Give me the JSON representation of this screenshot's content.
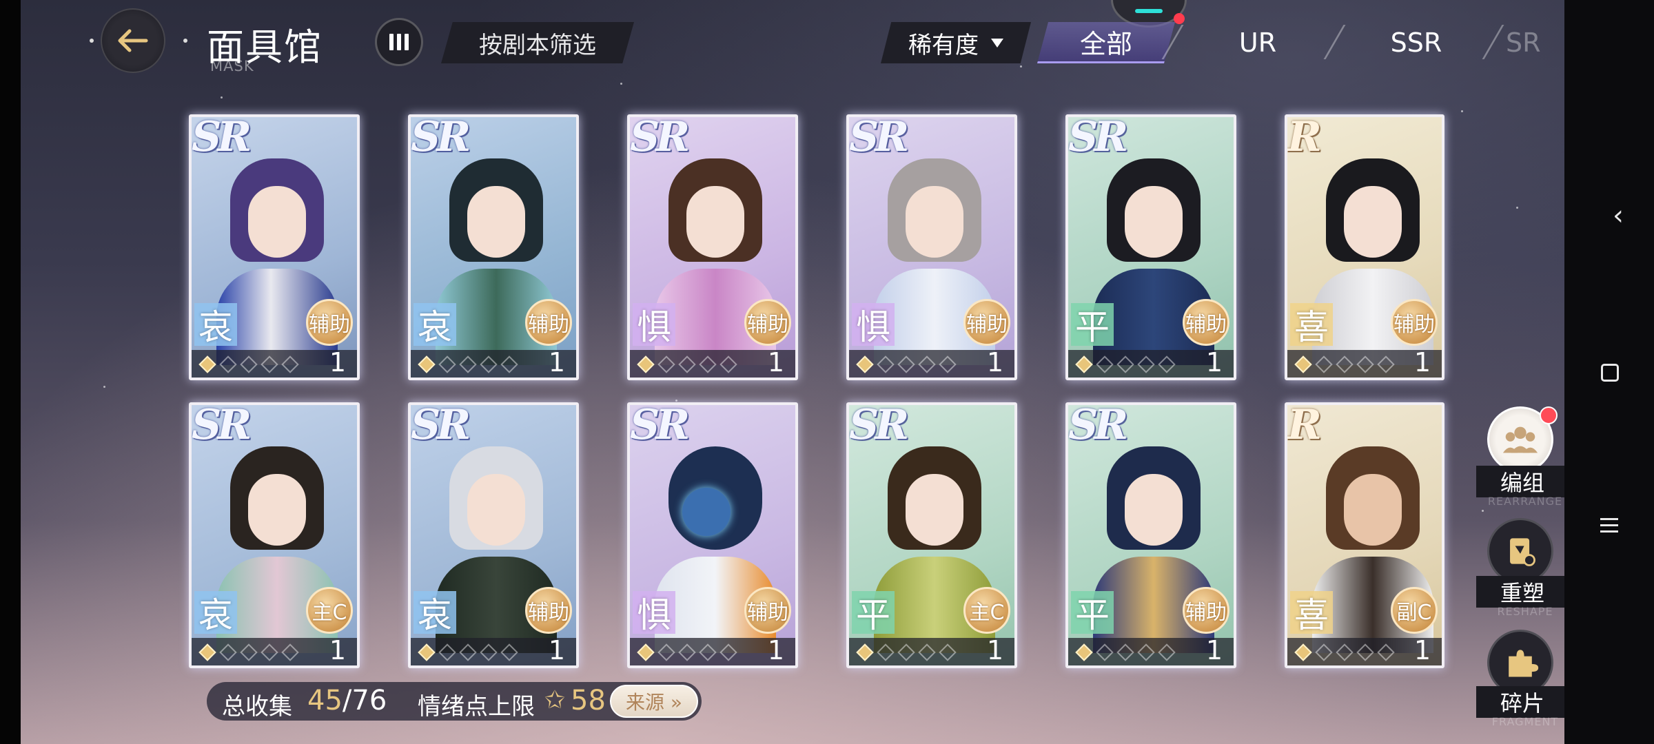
{
  "header": {
    "title": "面具馆",
    "subtitle": "MASK",
    "filter_script_label": "按剧本筛选",
    "rarity_dropdown_label": "稀有度",
    "tabs": [
      {
        "label": "全部",
        "active": true
      },
      {
        "label": "UR",
        "active": false
      },
      {
        "label": "SSR",
        "active": false
      },
      {
        "label": "SR",
        "active": false
      }
    ]
  },
  "cards": [
    {
      "rarity": "SR",
      "emotion": "哀",
      "role": "辅助",
      "count": "1"
    },
    {
      "rarity": "SR",
      "emotion": "哀",
      "role": "辅助",
      "count": "1"
    },
    {
      "rarity": "SR",
      "emotion": "惧",
      "role": "辅助",
      "count": "1"
    },
    {
      "rarity": "SR",
      "emotion": "惧",
      "role": "辅助",
      "count": "1"
    },
    {
      "rarity": "SR",
      "emotion": "平",
      "role": "辅助",
      "count": "1"
    },
    {
      "rarity": "R",
      "emotion": "喜",
      "role": "辅助",
      "count": "1"
    },
    {
      "rarity": "SR",
      "emotion": "哀",
      "role": "主C",
      "count": "1"
    },
    {
      "rarity": "SR",
      "emotion": "哀",
      "role": "辅助",
      "count": "1"
    },
    {
      "rarity": "SR",
      "emotion": "惧",
      "role": "辅助",
      "count": "1"
    },
    {
      "rarity": "SR",
      "emotion": "平",
      "role": "主C",
      "count": "1"
    },
    {
      "rarity": "SR",
      "emotion": "平",
      "role": "辅助",
      "count": "1"
    },
    {
      "rarity": "R",
      "emotion": "喜",
      "role": "副C",
      "count": "1"
    }
  ],
  "footer": {
    "collection_label": "总收集",
    "collection_have": "45",
    "collection_total": "/76",
    "emotion_cap_label": "情绪点上限",
    "emotion_cap_value": "58",
    "source_button_label": "来源 »"
  },
  "side_menu": {
    "team_label": "编组",
    "team_sub": "REARRANGE",
    "reshape_label": "重塑",
    "reshape_sub": "RESHAPE",
    "fragments_label": "碎片",
    "fragments_sub": "FRAGMENT"
  },
  "colors": {
    "accent_gold": "#e7c680",
    "tab_active": "#7a6ec8",
    "emotion_ai": "#8fc3f0",
    "emotion_ju": "#d2b0f0",
    "emotion_ping": "#7fd3ad",
    "emotion_xi": "#f0d28a"
  },
  "icons": {
    "back": "back-arrow-icon",
    "view_toggle": "columns-icon",
    "team": "group-icon",
    "reshape": "card-swap-icon",
    "fragments": "puzzle-icon"
  }
}
